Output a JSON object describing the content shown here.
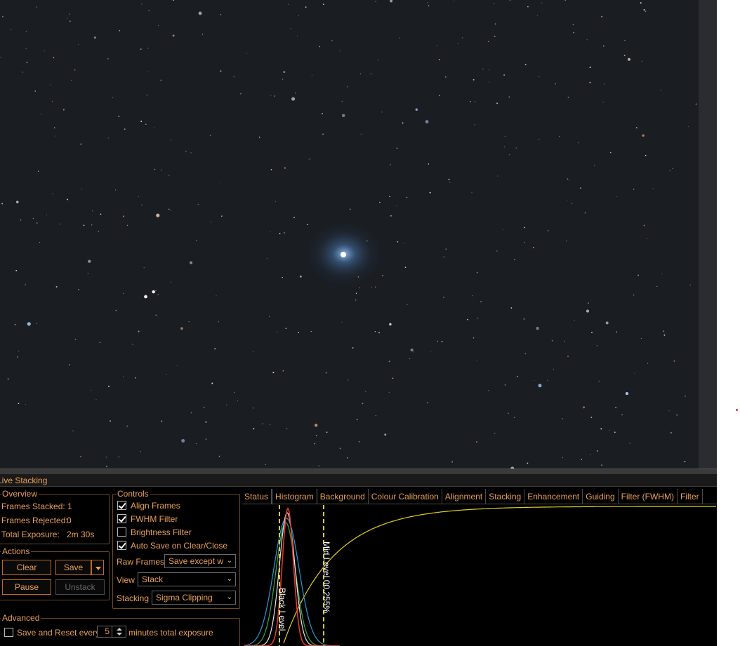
{
  "panel_title": "Live Stacking",
  "overview": {
    "title": "Overview",
    "frames_stacked_label": "Frames Stacked:",
    "frames_stacked_value": "1",
    "frames_rejected_label": "Frames Rejected:",
    "frames_rejected_value": "0",
    "total_exposure_label": "Total Exposure:",
    "total_exposure_value": "2m 30s"
  },
  "actions": {
    "title": "Actions",
    "clear_label": "Clear",
    "save_label": "Save",
    "pause_label": "Pause",
    "unstack_label": "Unstack"
  },
  "controls": {
    "title": "Controls",
    "align_frames": {
      "label": "Align Frames",
      "checked": true
    },
    "fwhm_filter": {
      "label": "FWHM Filter",
      "checked": true
    },
    "brightness_filter": {
      "label": "Brightness Filter",
      "checked": false
    },
    "auto_save": {
      "label": "Auto Save on Clear/Close",
      "checked": true
    },
    "raw_frames_label": "Raw Frames",
    "raw_frames_value": "Save except w",
    "view_label": "View",
    "view_value": "Stack",
    "stacking_label": "Stacking",
    "stacking_value": "Sigma Clipping"
  },
  "advanced": {
    "title": "Advanced",
    "save_reset_label": "Save and Reset every",
    "save_reset_checked": false,
    "minutes_value": "5",
    "minutes_suffix": "minutes total exposure"
  },
  "tabs": [
    {
      "label": "Status",
      "active": false
    },
    {
      "label": "Histogram",
      "active": true
    },
    {
      "label": "Background",
      "active": false
    },
    {
      "label": "Colour Calibration",
      "active": false
    },
    {
      "label": "Alignment",
      "active": false
    },
    {
      "label": "Stacking",
      "active": false
    },
    {
      "label": "Enhancement",
      "active": false
    },
    {
      "label": "Guiding",
      "active": false
    },
    {
      "label": "Filter (FWHM)",
      "active": false
    },
    {
      "label": "Filter",
      "active": false
    }
  ],
  "histogram": {
    "black_level_label": "Black Level",
    "mid_level_label": "Mid Level 00.255%",
    "colors": {
      "red": "#e23a2a",
      "green": "#3aa64a",
      "blue": "#2a9ad8",
      "luminance": "#e8e8e8",
      "curve": "#e0d020"
    }
  },
  "colors": {
    "accent": "#e8a058",
    "button_border": "#c06a20",
    "panel_bg": "#000000",
    "sky_bg": "#1a1d22"
  }
}
